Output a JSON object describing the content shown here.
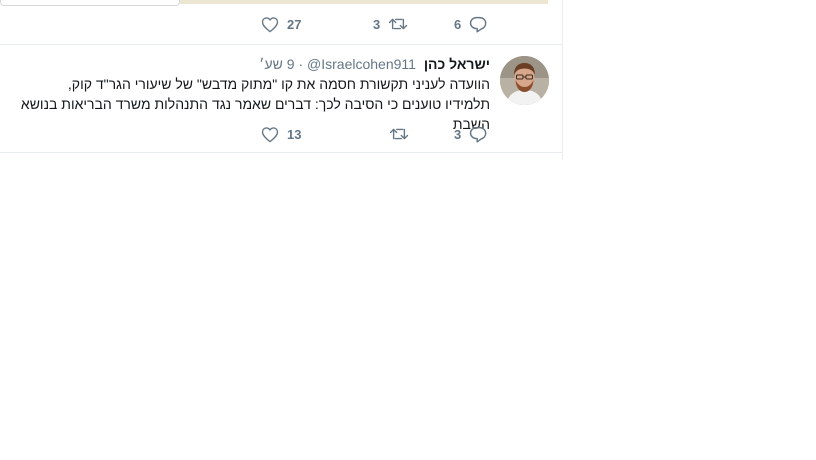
{
  "previous_tweet": {
    "replies": "6",
    "retweets": "3",
    "likes": "27"
  },
  "tweet": {
    "display_name": "ישראל כהן",
    "handle": "@Israelcohen911",
    "separator": "·",
    "timestamp": "9 שע׳",
    "text": "הוועדה לעניני תקשורת חסמה את קו \"מתוק מדבש\" של שיעורי הגר\"ד קוק, תלמידיו טוענים כי הסיבה לכך: דברים שאמר נגד התנהלות משרד הבריאות בנושא השבת",
    "replies": "3",
    "retweets": "",
    "likes": "13"
  },
  "icons": {
    "reply": "reply-icon",
    "retweet": "retweet-icon",
    "like": "heart-icon"
  },
  "colors": {
    "icon": "#657786",
    "text": "#14171a",
    "border": "#e6ecf0"
  }
}
